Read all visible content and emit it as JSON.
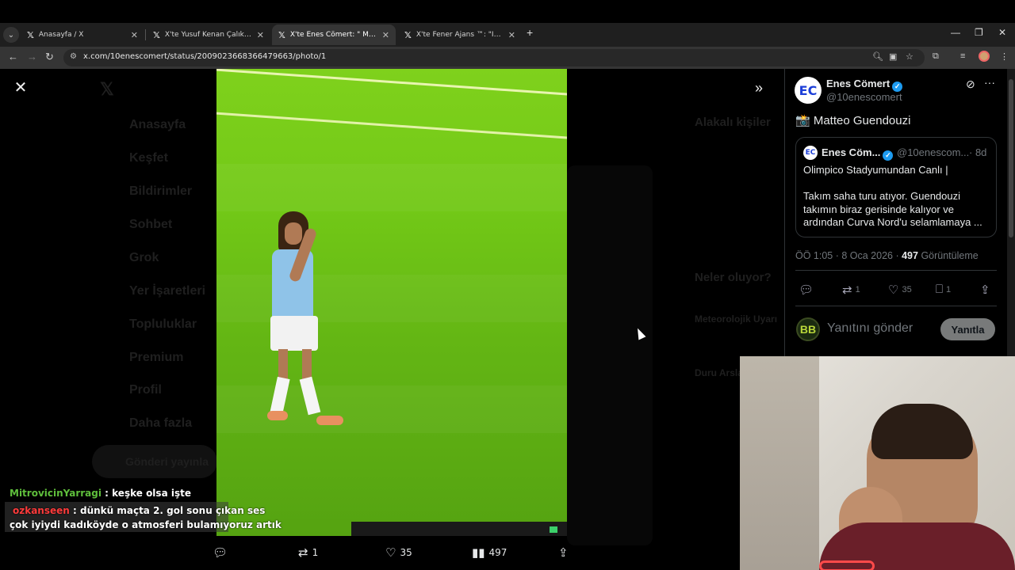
{
  "browser": {
    "tabs": [
      {
        "title": "Anasayfa / X",
        "active": false
      },
      {
        "title": "X'te Yusuf Kenan Çalık: \"Fenerb",
        "active": false
      },
      {
        "title": "X'te Enes Cömert: \" Matteo",
        "active": true
      },
      {
        "title": "X'te Fener Ajans ™: \"İrfan Can K",
        "active": false
      }
    ],
    "url": "x.com/10enescomert/status/2009023668366479663/photo/1"
  },
  "background_nav": {
    "items": [
      "Anasayfa",
      "Keşfet",
      "Bildirimler",
      "Sohbet",
      "Grok",
      "Yer İşaretleri",
      "Topluluklar",
      "Premium",
      "Profil",
      "Daha fazla"
    ],
    "post_button": "Gönderi yayınla",
    "trends_title": "Neler oluyor?",
    "related_title": "Alakalı kişiler",
    "trend_1": "Meteorolojik Uyarı",
    "trend_2": "Duru Arslan"
  },
  "photo_actions": {
    "retweets": "1",
    "likes": "35",
    "views": "497"
  },
  "chat": [
    {
      "user": "MitrovicinYarragi",
      "message": ": keşke olsa işte"
    },
    {
      "user": "ozkanseen",
      "message": ": dünkü maçta 2. gol sonu çıkan ses"
    },
    {
      "user": "",
      "message": "çok iyiydi kadıköyde o atmosferi bulamıyoruz artık"
    }
  ],
  "tweet": {
    "avatar_text": "EC",
    "name": "Enes Cömert",
    "handle": "@10enescomert",
    "text": "📸 Matteo Guendouzi",
    "quote": {
      "name": "Enes Cöm...",
      "handle": "@10enescom...",
      "time": "· 8d",
      "text": "Olimpico Stadyumundan Canlı |\n\nTakım saha turu atıyor. Guendouzi takımın biraz gerisinde kalıyor ve ardından Curva Nord'u selamlamaya ..."
    },
    "timestamp": "ÖÖ 1:05 · 8 Oca 2026 · ",
    "views": "497",
    "views_label": " Görüntüleme",
    "retweets": "1",
    "likes": "35",
    "bookmarks": "1",
    "reply_placeholder": "Yanıtını gönder",
    "reply_button": "Yanıtla",
    "reply_avatar_text": "BB"
  },
  "colors": {
    "verified": "#1d9bf0",
    "chat_user_1": "#5fbf3c",
    "chat_user_2": "#ff3b3b"
  }
}
